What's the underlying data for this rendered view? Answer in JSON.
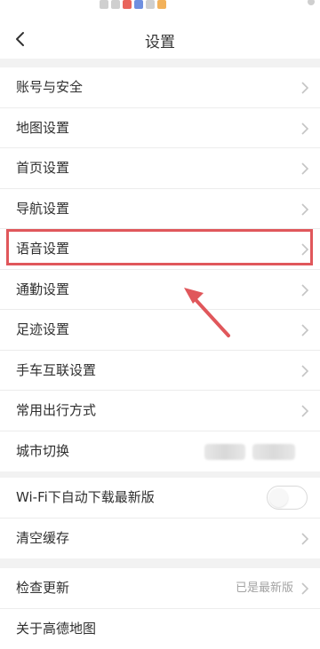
{
  "header": {
    "title": "设置"
  },
  "settings_group_1": [
    {
      "label": "账号与安全"
    },
    {
      "label": "地图设置"
    },
    {
      "label": "首页设置"
    },
    {
      "label": "导航设置"
    },
    {
      "label": "语音设置"
    },
    {
      "label": "通勤设置"
    },
    {
      "label": "足迹设置"
    },
    {
      "label": "手车互联设置"
    },
    {
      "label": "常用出行方式"
    },
    {
      "label": "城市切换"
    }
  ],
  "settings_group_2": [
    {
      "label": "Wi-Fi下自动下载最新版",
      "toggle": false
    },
    {
      "label": "清空缓存"
    }
  ],
  "settings_group_3": [
    {
      "label": "检查更新",
      "value": "已是最新版"
    },
    {
      "label": "关于高德地图"
    }
  ],
  "annotation": {
    "highlighted_item": "语音设置",
    "color": "#e0575b"
  }
}
